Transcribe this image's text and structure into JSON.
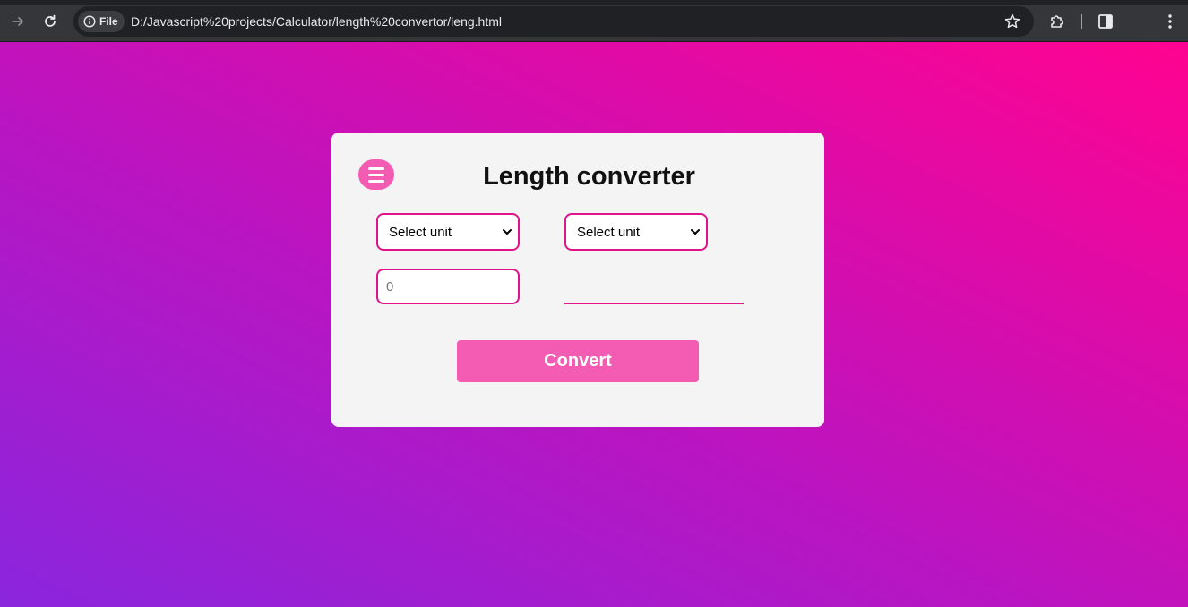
{
  "browser": {
    "back_icon": "arrow-left-icon",
    "reload_icon": "reload-icon",
    "security_chip_label": "File",
    "url": "D:/Javascript%20projects/Calculator/length%20convertor/leng.html",
    "bookmark_icon": "star-icon",
    "extensions_icon": "puzzle-icon",
    "sidepanel_icon": "side-panel-icon",
    "menu_icon": "kebab-menu-icon"
  },
  "app": {
    "title": "Length converter",
    "menu_icon": "hamburger-icon",
    "from_unit": {
      "selected": "Select unit"
    },
    "to_unit": {
      "selected": "Select unit"
    },
    "input_placeholder": "0",
    "result": "",
    "convert_label": "Convert",
    "colors": {
      "accent": "#f45bb2",
      "border": "#e0138a",
      "card_bg": "#f4f4f4",
      "gradient_start": "#8a26dd",
      "gradient_end": "#ff0390"
    }
  }
}
